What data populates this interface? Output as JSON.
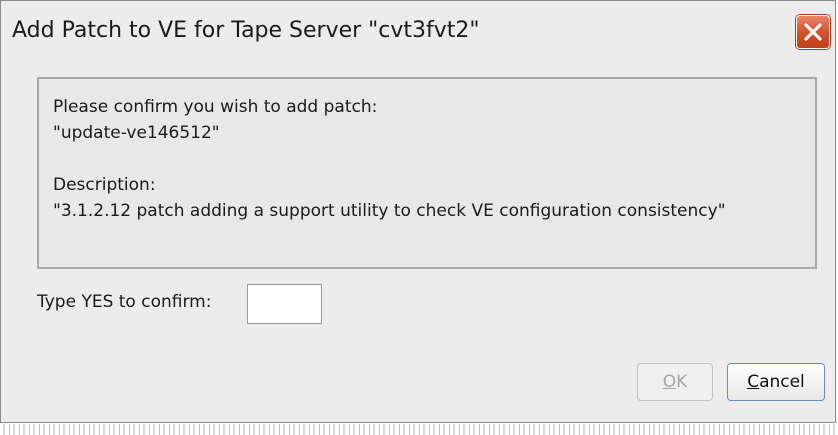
{
  "dialog": {
    "title": "Add Patch to VE for Tape Server \"cvt3fvt2\"",
    "close_icon": "close-icon",
    "accent_color": "#d5532f"
  },
  "message": {
    "line1": "Please confirm you wish to add patch:",
    "line2": "\"update-ve146512\"",
    "line3": "Description:",
    "line4": "\"3.1.2.12 patch adding a support utility to check VE configuration consistency\""
  },
  "confirm": {
    "label": "Type YES to confirm:",
    "value": ""
  },
  "buttons": {
    "ok_label_mnemonic": "O",
    "ok_label_rest": "K",
    "cancel_label_mnemonic": "C",
    "cancel_label_rest": "ancel"
  }
}
